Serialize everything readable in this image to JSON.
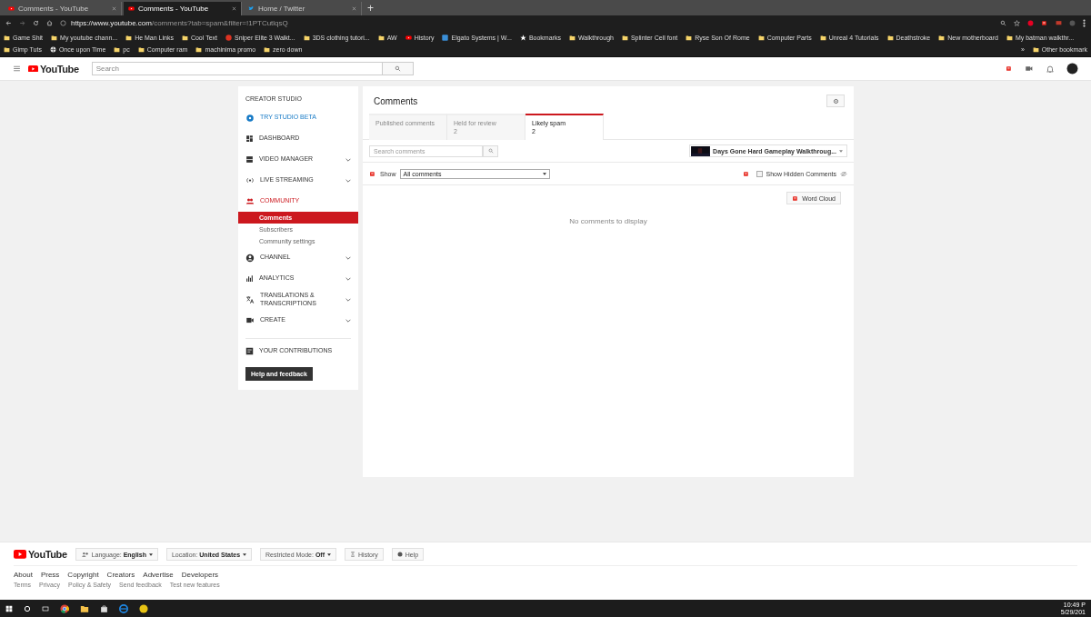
{
  "browser": {
    "tabs": [
      {
        "title": "Comments - YouTube",
        "kind": "video",
        "selected": false
      },
      {
        "title": "Comments - YouTube",
        "kind": "video",
        "selected": true
      },
      {
        "title": "Home / Twitter",
        "kind": "bird",
        "selected": false
      }
    ],
    "new_tab": "+",
    "url_host": "https://www.youtube.com",
    "url_path": "/comments?tab=spam&filter=!1PTCutlqsQ",
    "bookmarks": [
      {
        "label": "Game Shit",
        "kind": "folder"
      },
      {
        "label": "My youtube chann...",
        "kind": "folder"
      },
      {
        "label": "He Man Links",
        "kind": "folder"
      },
      {
        "label": "Cool Text",
        "kind": "folder"
      },
      {
        "label": "Sniper Elite 3 Walkt...",
        "kind": "badge"
      },
      {
        "label": "3DS clothing tutori...",
        "kind": "folder"
      },
      {
        "label": "AW",
        "kind": "folder"
      },
      {
        "label": "History",
        "kind": "video"
      },
      {
        "label": "Elgato Systems | W...",
        "kind": "app"
      },
      {
        "label": "Bookmarks",
        "kind": "star"
      },
      {
        "label": "Walkthrough",
        "kind": "folder"
      },
      {
        "label": "Splinter Cell font",
        "kind": "folder"
      },
      {
        "label": "Ryse Son Of Rome",
        "kind": "folder"
      },
      {
        "label": "Computer Parts",
        "kind": "folder"
      },
      {
        "label": "Unreal 4 Tutorials",
        "kind": "folder"
      },
      {
        "label": "Deathstroke",
        "kind": "folder"
      },
      {
        "label": "New motherboard",
        "kind": "folder"
      },
      {
        "label": "My batman walkthr...",
        "kind": "folder"
      },
      {
        "label": "Gimp Tuts",
        "kind": "folder"
      },
      {
        "label": "Once upon Time",
        "kind": "globe"
      },
      {
        "label": "pc",
        "kind": "folder"
      },
      {
        "label": "Computer ram",
        "kind": "folder"
      },
      {
        "label": "machinima promo",
        "kind": "folder"
      },
      {
        "label": "zero down",
        "kind": "folder"
      }
    ],
    "more_bookmarks": "»",
    "other_bookmarks": "Other bookmark"
  },
  "header": {
    "logo": "YouTube",
    "search": {
      "placeholder": "Search"
    }
  },
  "sidebar": {
    "title": "CREATOR STUDIO",
    "items": [
      {
        "label": "TRY STUDIO BETA",
        "kind": "promo",
        "chevron": false,
        "selected": false
      },
      {
        "label": "DASHBOARD",
        "kind": "nav",
        "chevron": false,
        "selected": false
      },
      {
        "label": "VIDEO MANAGER",
        "kind": "nav",
        "chevron": true,
        "selected": false
      },
      {
        "label": "LIVE STREAMING",
        "kind": "nav",
        "chevron": true,
        "selected": false
      },
      {
        "label": "COMMUNITY",
        "kind": "nav",
        "chevron": false,
        "selected": true,
        "children": [
          {
            "label": "Comments",
            "selected": true
          },
          {
            "label": "Subscribers",
            "selected": false
          },
          {
            "label": "Community settings",
            "selected": false
          }
        ]
      },
      {
        "label": "CHANNEL",
        "kind": "nav",
        "chevron": true,
        "selected": false
      },
      {
        "label": "ANALYTICS",
        "kind": "nav",
        "chevron": true,
        "selected": false
      },
      {
        "label": "TRANSLATIONS & TRANSCRIPTIONS",
        "kind": "nav",
        "chevron": true,
        "selected": false
      },
      {
        "label": "CREATE",
        "kind": "nav",
        "chevron": true,
        "selected": false
      }
    ],
    "contributions": "YOUR CONTRIBUTIONS",
    "help_button": "Help and feedback"
  },
  "main": {
    "title": "Comments",
    "tabs": [
      {
        "label": "Published comments",
        "selected": false
      },
      {
        "label": "Held for review",
        "count": "2",
        "selected": false
      },
      {
        "label": "Likely spam",
        "count": "2",
        "selected": true
      }
    ],
    "search": {
      "placeholder": "Search comments"
    },
    "video_selector": "Days Gone Hard Gameplay Walkthroug...",
    "show_label": "Show",
    "show_value": "All comments",
    "show_hidden": {
      "label": "Show Hidden Comments",
      "checked": false
    },
    "word_cloud": "Word Cloud",
    "empty_message": "No comments to display"
  },
  "footer": {
    "logo": "YouTube",
    "buttons": [
      {
        "text": "Language: **English**",
        "kind": "language"
      },
      {
        "text": "Location: **United States**",
        "kind": "dropdown"
      },
      {
        "text": "Restricted Mode: **Off**",
        "kind": "dropdown"
      },
      {
        "text": "History",
        "kind": "history"
      },
      {
        "text": "Help",
        "kind": "help"
      }
    ],
    "links": [
      "About",
      "Press",
      "Copyright",
      "Creators",
      "Advertise",
      "Developers"
    ],
    "small_links": [
      "Terms",
      "Privacy",
      "Policy & Safety",
      "Send feedback",
      "Test new features"
    ]
  },
  "taskbar": {
    "time": "10:49 P",
    "date": "5/29/201"
  }
}
